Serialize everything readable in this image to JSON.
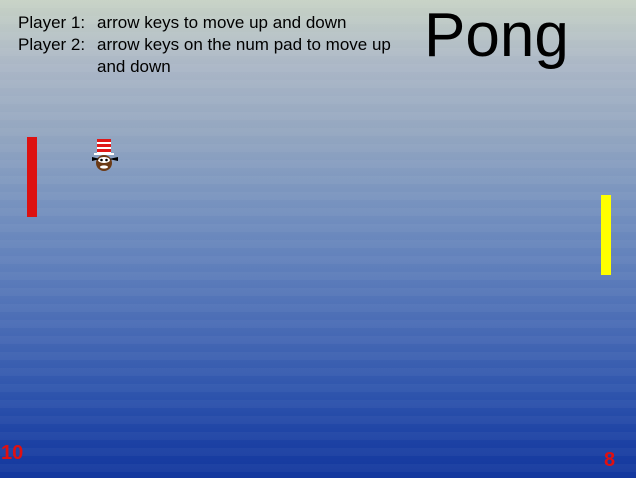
{
  "game": {
    "title": "Pong"
  },
  "instructions": [
    {
      "player": "Player 1:",
      "text": "arrow keys to move up and down"
    },
    {
      "player": "Player 2:",
      "text": "arrow keys on the num pad to move up and down"
    }
  ],
  "scores": {
    "player1": "10",
    "player2": "8"
  },
  "paddles": {
    "left_color": "#dd1111",
    "right_color": "#ffff00"
  },
  "ball": {
    "icon": "cat-in-the-hat-icon"
  },
  "colors": {
    "score": "#e01010",
    "background_top": "#c7d2c5",
    "background_bottom": "#13379e"
  }
}
